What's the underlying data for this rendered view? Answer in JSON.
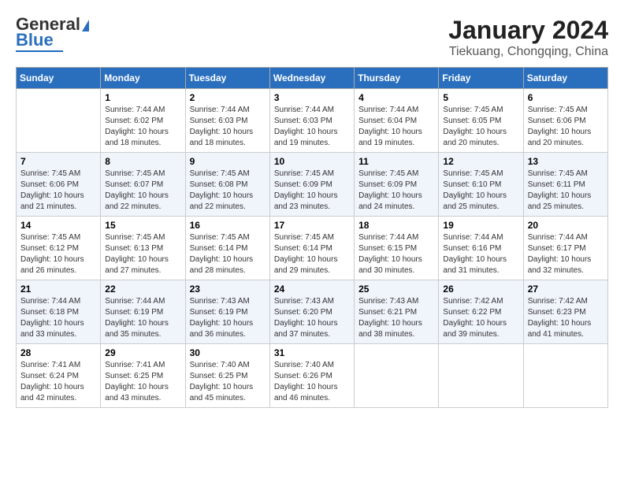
{
  "header": {
    "logo_line1": "General",
    "logo_line2": "Blue",
    "title": "January 2024",
    "location": "Tiekuang, Chongqing, China"
  },
  "columns": [
    "Sunday",
    "Monday",
    "Tuesday",
    "Wednesday",
    "Thursday",
    "Friday",
    "Saturday"
  ],
  "weeks": [
    [
      {
        "day": "",
        "info": ""
      },
      {
        "day": "1",
        "info": "Sunrise: 7:44 AM\nSunset: 6:02 PM\nDaylight: 10 hours\nand 18 minutes."
      },
      {
        "day": "2",
        "info": "Sunrise: 7:44 AM\nSunset: 6:03 PM\nDaylight: 10 hours\nand 18 minutes."
      },
      {
        "day": "3",
        "info": "Sunrise: 7:44 AM\nSunset: 6:03 PM\nDaylight: 10 hours\nand 19 minutes."
      },
      {
        "day": "4",
        "info": "Sunrise: 7:44 AM\nSunset: 6:04 PM\nDaylight: 10 hours\nand 19 minutes."
      },
      {
        "day": "5",
        "info": "Sunrise: 7:45 AM\nSunset: 6:05 PM\nDaylight: 10 hours\nand 20 minutes."
      },
      {
        "day": "6",
        "info": "Sunrise: 7:45 AM\nSunset: 6:06 PM\nDaylight: 10 hours\nand 20 minutes."
      }
    ],
    [
      {
        "day": "7",
        "info": "Sunrise: 7:45 AM\nSunset: 6:06 PM\nDaylight: 10 hours\nand 21 minutes."
      },
      {
        "day": "8",
        "info": "Sunrise: 7:45 AM\nSunset: 6:07 PM\nDaylight: 10 hours\nand 22 minutes."
      },
      {
        "day": "9",
        "info": "Sunrise: 7:45 AM\nSunset: 6:08 PM\nDaylight: 10 hours\nand 22 minutes."
      },
      {
        "day": "10",
        "info": "Sunrise: 7:45 AM\nSunset: 6:09 PM\nDaylight: 10 hours\nand 23 minutes."
      },
      {
        "day": "11",
        "info": "Sunrise: 7:45 AM\nSunset: 6:09 PM\nDaylight: 10 hours\nand 24 minutes."
      },
      {
        "day": "12",
        "info": "Sunrise: 7:45 AM\nSunset: 6:10 PM\nDaylight: 10 hours\nand 25 minutes."
      },
      {
        "day": "13",
        "info": "Sunrise: 7:45 AM\nSunset: 6:11 PM\nDaylight: 10 hours\nand 25 minutes."
      }
    ],
    [
      {
        "day": "14",
        "info": "Sunrise: 7:45 AM\nSunset: 6:12 PM\nDaylight: 10 hours\nand 26 minutes."
      },
      {
        "day": "15",
        "info": "Sunrise: 7:45 AM\nSunset: 6:13 PM\nDaylight: 10 hours\nand 27 minutes."
      },
      {
        "day": "16",
        "info": "Sunrise: 7:45 AM\nSunset: 6:14 PM\nDaylight: 10 hours\nand 28 minutes."
      },
      {
        "day": "17",
        "info": "Sunrise: 7:45 AM\nSunset: 6:14 PM\nDaylight: 10 hours\nand 29 minutes."
      },
      {
        "day": "18",
        "info": "Sunrise: 7:44 AM\nSunset: 6:15 PM\nDaylight: 10 hours\nand 30 minutes."
      },
      {
        "day": "19",
        "info": "Sunrise: 7:44 AM\nSunset: 6:16 PM\nDaylight: 10 hours\nand 31 minutes."
      },
      {
        "day": "20",
        "info": "Sunrise: 7:44 AM\nSunset: 6:17 PM\nDaylight: 10 hours\nand 32 minutes."
      }
    ],
    [
      {
        "day": "21",
        "info": "Sunrise: 7:44 AM\nSunset: 6:18 PM\nDaylight: 10 hours\nand 33 minutes."
      },
      {
        "day": "22",
        "info": "Sunrise: 7:44 AM\nSunset: 6:19 PM\nDaylight: 10 hours\nand 35 minutes."
      },
      {
        "day": "23",
        "info": "Sunrise: 7:43 AM\nSunset: 6:19 PM\nDaylight: 10 hours\nand 36 minutes."
      },
      {
        "day": "24",
        "info": "Sunrise: 7:43 AM\nSunset: 6:20 PM\nDaylight: 10 hours\nand 37 minutes."
      },
      {
        "day": "25",
        "info": "Sunrise: 7:43 AM\nSunset: 6:21 PM\nDaylight: 10 hours\nand 38 minutes."
      },
      {
        "day": "26",
        "info": "Sunrise: 7:42 AM\nSunset: 6:22 PM\nDaylight: 10 hours\nand 39 minutes."
      },
      {
        "day": "27",
        "info": "Sunrise: 7:42 AM\nSunset: 6:23 PM\nDaylight: 10 hours\nand 41 minutes."
      }
    ],
    [
      {
        "day": "28",
        "info": "Sunrise: 7:41 AM\nSunset: 6:24 PM\nDaylight: 10 hours\nand 42 minutes."
      },
      {
        "day": "29",
        "info": "Sunrise: 7:41 AM\nSunset: 6:25 PM\nDaylight: 10 hours\nand 43 minutes."
      },
      {
        "day": "30",
        "info": "Sunrise: 7:40 AM\nSunset: 6:25 PM\nDaylight: 10 hours\nand 45 minutes."
      },
      {
        "day": "31",
        "info": "Sunrise: 7:40 AM\nSunset: 6:26 PM\nDaylight: 10 hours\nand 46 minutes."
      },
      {
        "day": "",
        "info": ""
      },
      {
        "day": "",
        "info": ""
      },
      {
        "day": "",
        "info": ""
      }
    ]
  ]
}
